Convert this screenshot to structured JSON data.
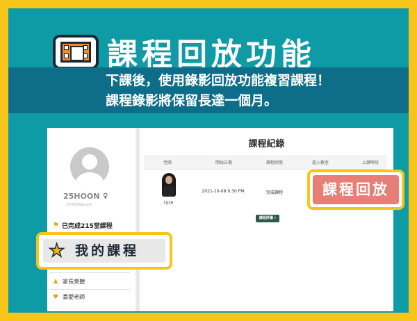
{
  "header": {
    "title": "課程回放功能",
    "subtitle_line1": "下課後，使用錄影回放功能複習課程！",
    "subtitle_line2": "課程錄影將保留長達一個月。",
    "logo_icon": "film-icon"
  },
  "sidebar": {
    "username": "25HOON",
    "user_icon": "lightbulb-icon",
    "email": "25HOON@com",
    "completed_label": "已完成215堂課程",
    "items": [
      {
        "label": "家長旁聽",
        "icon": "person-icon"
      },
      {
        "label": "喜愛老師",
        "icon": "heart-icon"
      }
    ]
  },
  "main": {
    "page_title": "課程紀錄",
    "columns": [
      "老師",
      "開始日期",
      "課程狀態",
      "進入教室",
      "上課時段"
    ],
    "rows": [
      {
        "teacher": "Lyza",
        "start": "2021-10-08  9:30 PM",
        "status": "完成課程"
      }
    ],
    "review_button": "課程評價 ▾"
  },
  "callouts": {
    "my_courses": "我的課程",
    "replay": "課程回放"
  },
  "colors": {
    "border_yellow": "#f7c51a",
    "teal": "#0e9ba6",
    "band": "#0e6e89",
    "replay_pink": "#e87e78",
    "button_green": "#2e5a4d"
  }
}
